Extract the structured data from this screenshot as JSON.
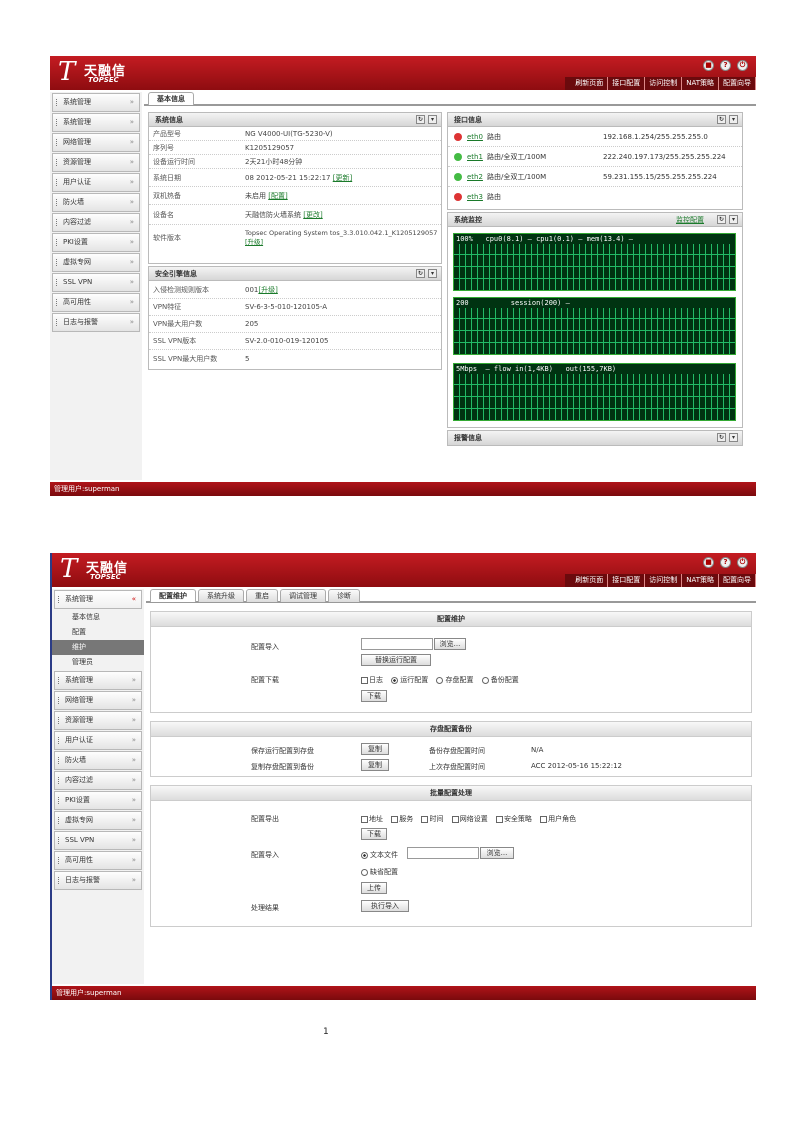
{
  "header": {
    "brand_cn": "天融信",
    "brand_en": "TOPSEC",
    "links": [
      "刷新页面",
      "接口配置",
      "访问控制",
      "NAT策略",
      "配置向导"
    ],
    "icons": [
      "lock-icon",
      "help-icon",
      "power-icon"
    ]
  },
  "screen1": {
    "sidebar": [
      "系统管理",
      "系统管理",
      "网络管理",
      "资源管理",
      "用户认证",
      "防火墙",
      "内容过滤",
      "PKI设置",
      "虚拟专网",
      "SSL VPN",
      "高可用性",
      "日志与报警"
    ],
    "tab": "基本信息",
    "sysinfo": {
      "title": "系统信息",
      "rows": [
        {
          "k": "产品型号",
          "v": "NG V4000-UI(TG-5230-V)",
          "link": ""
        },
        {
          "k": "序列号",
          "v": "K1205129057",
          "link": ""
        },
        {
          "k": "设备运行时间",
          "v": "2天21小时48分钟",
          "link": ""
        },
        {
          "k": "系统日期",
          "v": "08 2012-05-21 15:22:17",
          "link": "[更新]"
        },
        {
          "k": "双机热备",
          "v": "未启用",
          "link": "[配置]"
        },
        {
          "k": "设备名",
          "v": "天融信防火墙系统",
          "link": "[更改]"
        },
        {
          "k": "软件版本",
          "v": "Topsec Operating System tos_3.3.010.042.1_K1205129057",
          "link": "[升级]"
        }
      ]
    },
    "secinfo": {
      "title": "安全引擎信息",
      "rows": [
        {
          "k": "入侵检测规则版本",
          "v": "001",
          "link": "[升级]"
        },
        {
          "k": "VPN特征",
          "v": "SV-6-3-5-010-120105-A",
          "link": ""
        },
        {
          "k": "VPN最大用户数",
          "v": "205",
          "link": ""
        },
        {
          "k": "SSL VPN版本",
          "v": "SV-2.0-010-019-120105",
          "link": ""
        },
        {
          "k": "SSL VPN最大用户数",
          "v": "5",
          "link": ""
        }
      ]
    },
    "ifinfo": {
      "title": "接口信息",
      "rows": [
        {
          "name": "eth0",
          "mode": "路由",
          "addr": "192.168.1.254/255.255.255.0",
          "color": "#d33"
        },
        {
          "name": "eth1",
          "mode": "路由/全双工/100M",
          "addr": "222.240.197.173/255.255.255.224",
          "color": "#4b4"
        },
        {
          "name": "eth2",
          "mode": "路由/全双工/100M",
          "addr": "59.231.155.15/255.255.255.224",
          "color": "#4b4"
        },
        {
          "name": "eth3",
          "mode": "路由",
          "addr": "",
          "color": "#d33"
        }
      ]
    },
    "monitor": {
      "title": "系统监控",
      "action": "监控配置",
      "graphs": [
        "100%   cpu0(8.1) — cpu1(0.1) — mem(13.4) —",
        "200          session(200) —",
        "5Mbps  — flow in(1,4KB)   out(155,7KB)"
      ]
    },
    "alarm": {
      "title": "报警信息"
    },
    "footer": "管理用户:superman"
  },
  "screen2": {
    "sidebar_top": "系统管理",
    "sidebar_subs": [
      "基本信息",
      "配置",
      "维护",
      "管理员"
    ],
    "sidebar_rest": [
      "系统管理",
      "网络管理",
      "资源管理",
      "用户认证",
      "防火墙",
      "内容过滤",
      "PKI设置",
      "虚拟专网",
      "SSL VPN",
      "高可用性",
      "日志与报警"
    ],
    "tabs": [
      "配置维护",
      "系统升级",
      "重启",
      "调试管理",
      "诊断"
    ],
    "config": {
      "title": "配置维护",
      "import_label": "配置导入",
      "browse": "浏览...",
      "import_btn": "替换运行配置",
      "export_label": "配置下载",
      "export_options": [
        "日志",
        "运行配置",
        "存盘配置",
        "备份配置"
      ],
      "download": "下载"
    },
    "backup": {
      "title": "存盘配置备份",
      "r1": "保存运行配置到存盘",
      "r1_btn": "复制",
      "r1_info": "备份存盘配置时间",
      "r1_val": "N/A",
      "r2": "复制存盘配置到备份",
      "r2_btn": "复制",
      "r2_info": "上次存盘配置时间",
      "r2_val": "ACC 2012-05-16 15:22:12"
    },
    "batch": {
      "title": "批量配置处理",
      "export_label": "配置导出",
      "items": [
        "地址",
        "服务",
        "时间",
        "网络设置",
        "安全策略",
        "用户角色"
      ],
      "download": "下载",
      "import_label": "配置导入",
      "opt_file": "文本文件",
      "browse": "浏览...",
      "opt_default": "缺省配置",
      "upload": "上传",
      "result_label": "处理结果",
      "result_btn": "执行导入"
    },
    "footer": "管理用户:superman"
  },
  "page_number": "1"
}
